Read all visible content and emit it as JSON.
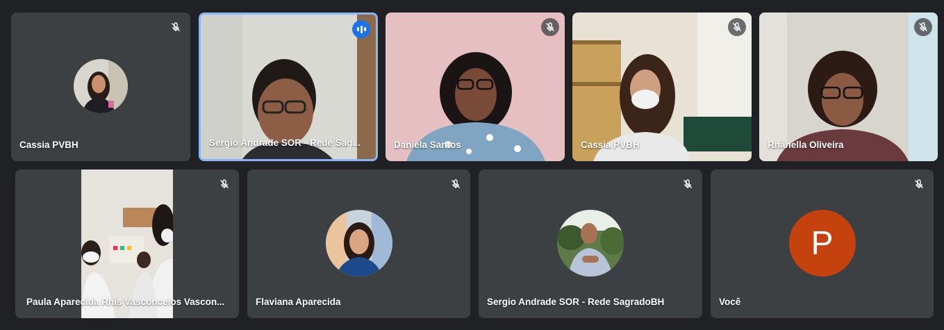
{
  "participants": [
    {
      "name": "Cassia PVBH",
      "mic": "muted",
      "view": "avatar"
    },
    {
      "name": "Sergio Andrade SOR - Rede Sag...",
      "mic": "speaking",
      "view": "video"
    },
    {
      "name": "Daniela Santos",
      "mic": "muted",
      "view": "video"
    },
    {
      "name": "Cassia PVBH",
      "mic": "muted",
      "view": "video"
    },
    {
      "name": "Rhânella Oliveira",
      "mic": "muted",
      "view": "video"
    },
    {
      "name": "Paula Aparecida Rhis Vasconcelos Vascon...",
      "mic": "muted",
      "view": "video"
    },
    {
      "name": "Flaviana Aparecida",
      "mic": "muted",
      "view": "avatar"
    },
    {
      "name": "Sergio Andrade SOR - Rede SagradoBH",
      "mic": "muted",
      "view": "avatar"
    },
    {
      "name": "Você",
      "mic": "muted",
      "view": "letter-avatar",
      "avatar_letter": "P",
      "avatar_color": "#c5410e"
    }
  ],
  "colors": {
    "background": "#202124",
    "tile": "#3c4043",
    "speaking_border": "#8ab4f8",
    "speaking_indicator": "#1a73e8"
  },
  "icons": {
    "muted": "mic-off-icon",
    "speaking": "audio-level-icon"
  }
}
